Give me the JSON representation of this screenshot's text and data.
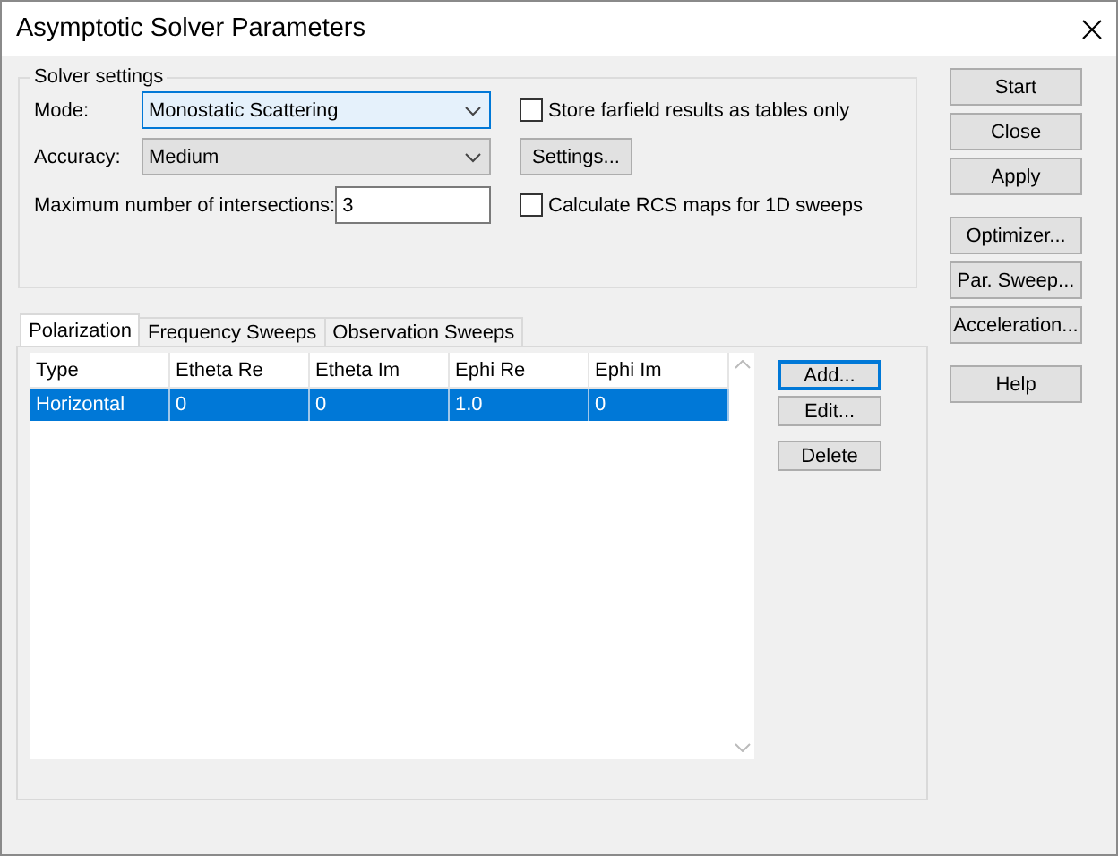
{
  "window": {
    "title": "Asymptotic Solver Parameters"
  },
  "solver_settings": {
    "title": "Solver settings",
    "rows": [
      {
        "label": "Mode:",
        "field": {
          "kind": "dropdown",
          "value": "Monostatic Scattering",
          "focused": true
        },
        "side": {
          "kind": "checkbox",
          "label": "Store farfield results as tables only",
          "checked": false
        }
      },
      {
        "label": "Accuracy:",
        "field": {
          "kind": "dropdown",
          "value": "Medium",
          "focused": false
        },
        "side": {
          "kind": "button",
          "label": "Settings..."
        }
      },
      {
        "label": "Maximum number of intersections:",
        "field": {
          "kind": "input",
          "value": "3",
          "focused": false
        },
        "side": {
          "kind": "checkbox",
          "label": "Calculate RCS maps for 1D sweeps",
          "checked": false
        }
      }
    ]
  },
  "tabs": [
    {
      "label": "Polarization",
      "selected": true
    },
    {
      "label": "Frequency Sweeps",
      "selected": false
    },
    {
      "label": "Observation Sweeps",
      "selected": false
    }
  ],
  "table": {
    "columns": [
      "Type",
      "Etheta Re",
      "Etheta Im",
      "Ephi Re",
      "Ephi Im"
    ],
    "rows": [
      {
        "cells": [
          "Horizontal",
          "0",
          "0",
          "1.0",
          "0"
        ],
        "selected": true
      }
    ]
  },
  "table_buttons": [
    {
      "label": "Add...",
      "default": true
    },
    {
      "label": "Edit...",
      "default": false
    },
    {
      "label": "Delete",
      "default": false
    }
  ],
  "side_button_groups": [
    [
      "Start",
      "Close",
      "Apply"
    ],
    [
      "Optimizer...",
      "Par. Sweep...",
      "Acceleration..."
    ],
    [
      "Help"
    ]
  ]
}
